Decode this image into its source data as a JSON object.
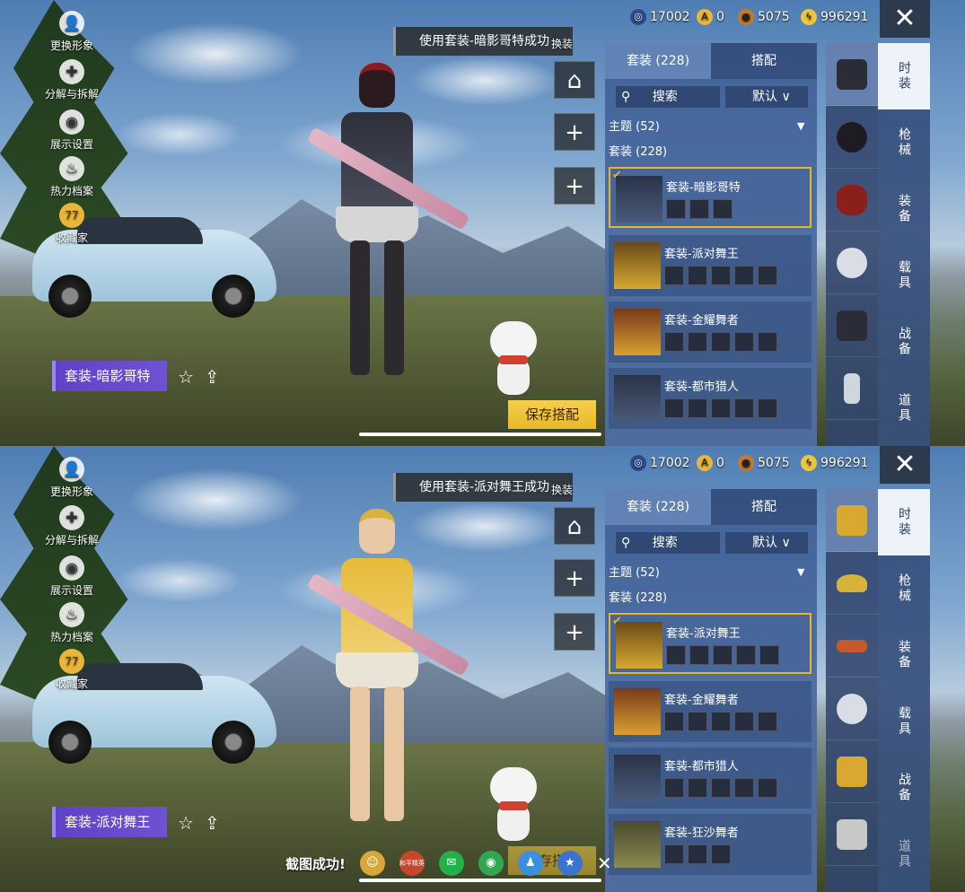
{
  "currencies": [
    {
      "icon": "uc-icon",
      "value": "17002",
      "color": "#2c4a8c"
    },
    {
      "icon": "a-coin-icon",
      "value": "0",
      "color": "#e9b53a"
    },
    {
      "icon": "bp-coin-icon",
      "value": "5075",
      "color": "#c47a2b"
    },
    {
      "icon": "lightning-coin-icon",
      "value": "996291",
      "color": "#f0c53d"
    }
  ],
  "left_tools": [
    {
      "label": "更换形象",
      "icon": "person-icon"
    },
    {
      "label": "分解与拆解",
      "icon": "puzzle-icon"
    },
    {
      "label": "展示设置",
      "icon": "eye-icon"
    },
    {
      "label": "热力档案",
      "icon": "flame-icon"
    },
    {
      "label": "收藏家",
      "icon": "collector-badge-icon"
    }
  ],
  "collector_level": "77",
  "swap_label": "换装",
  "save_label": "保存搭配",
  "tabs": [
    "套装 (228)",
    "搭配"
  ],
  "search_placeholder": "搜索",
  "sort_label": "默认",
  "theme_header": "主题 (52)",
  "set_header": "套装 (228)",
  "categories": [
    "时装",
    "枪械",
    "装备",
    "载具",
    "战备",
    "道具"
  ],
  "top": {
    "toast": "使用套装-暗影哥特成功",
    "outfit_tag": "套装-暗影哥特",
    "items": [
      {
        "name": "套装-暗影哥特",
        "selected": true
      },
      {
        "name": "套装-派对舞王",
        "selected": false
      },
      {
        "name": "套装-金耀舞者",
        "selected": false
      },
      {
        "name": "套装-都市猎人",
        "selected": false
      }
    ]
  },
  "bottom": {
    "toast": "使用套装-派对舞王成功",
    "outfit_tag": "套装-派对舞王",
    "items": [
      {
        "name": "套装-派对舞王",
        "selected": true
      },
      {
        "name": "套装-金耀舞者",
        "selected": false
      },
      {
        "name": "套装-都市猎人",
        "selected": false
      },
      {
        "name": "套装-狂沙舞者",
        "selected": false
      }
    ],
    "share": {
      "label": "截图成功!",
      "targets": [
        {
          "icon": "game-center-icon",
          "color": "#d9a63a"
        },
        {
          "icon": "peace-elite-icon",
          "color": "#c6462b",
          "text": "和平精英"
        },
        {
          "icon": "wechat-icon",
          "color": "#23b14a"
        },
        {
          "icon": "moments-icon",
          "color": "#2fa84f"
        },
        {
          "icon": "qq-icon",
          "color": "#3a8fe0"
        },
        {
          "icon": "qzone-icon",
          "color": "#3a74d0"
        }
      ],
      "close_icon": "close-icon"
    }
  },
  "colors": {
    "accent_gold": "#e8b828",
    "tag_purple": "#5f42c6",
    "panel_blue": "#4a6aa6"
  }
}
